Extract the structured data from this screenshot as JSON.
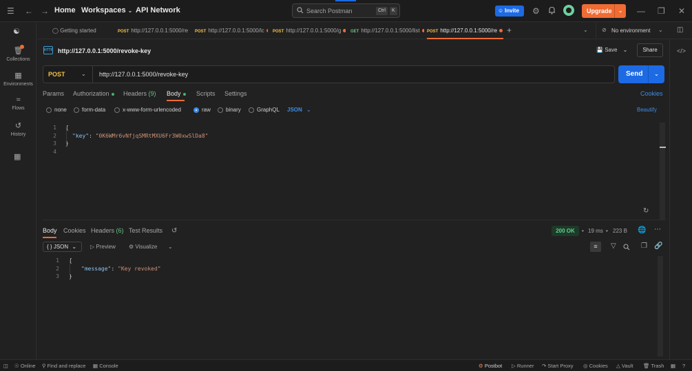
{
  "titlebar": {
    "home": "Home",
    "workspaces": "Workspaces",
    "api_network": "API Network",
    "search_placeholder": "Search Postman",
    "kbd_ctrl": "Ctrl",
    "kbd_k": "K",
    "invite": "Invite",
    "upgrade": "Upgrade"
  },
  "sidebar": {
    "items": [
      {
        "label": "Collections",
        "icon": "collections-icon"
      },
      {
        "label": "Environments",
        "icon": "environments-icon"
      },
      {
        "label": "Flows",
        "icon": "flows-icon"
      },
      {
        "label": "History",
        "icon": "history-icon"
      }
    ]
  },
  "tabs": {
    "getting_started": "Getting started",
    "items": [
      {
        "method": "POST",
        "url": "http://127.0.0.1:5000/re"
      },
      {
        "method": "POST",
        "url": "http://127.0.0.1:5000/lc"
      },
      {
        "method": "POST",
        "url": "http://127.0.0.1:5000/g"
      },
      {
        "method": "GET",
        "url": "http://127.0.0.1:5000/list"
      },
      {
        "method": "POST",
        "url": "http://127.0.0.1:5000/re"
      }
    ],
    "environment": "No environment"
  },
  "request": {
    "title": "http://127.0.0.1:5000/revoke-key",
    "save": "Save",
    "share": "Share",
    "method": "POST",
    "url": "http://127.0.0.1:5000/revoke-key",
    "send": "Send",
    "subtabs": {
      "params": "Params",
      "authorization": "Authorization",
      "headers": "Headers",
      "headers_count": "(9)",
      "body": "Body",
      "scripts": "Scripts",
      "settings": "Settings"
    },
    "cookies": "Cookies",
    "beautify": "Beautify",
    "body_types": [
      "none",
      "form-data",
      "x-www-form-urlencoded",
      "raw",
      "binary",
      "GraphQL"
    ],
    "body_format": "JSON",
    "code": {
      "line1": "{",
      "line2_key": "\"key\"",
      "line2_sep": ": ",
      "line2_val": "\"0K6WMr6vNfjqSMRtMXU6Fr3W0xwSlDa8\"",
      "line3": "}",
      "lines": [
        "1",
        "2",
        "3",
        "4"
      ]
    }
  },
  "response": {
    "tabs": {
      "body": "Body",
      "cookies": "Cookies",
      "headers": "Headers",
      "headers_count": "(6)",
      "test_results": "Test Results"
    },
    "status": "200 OK",
    "time": "19 ms",
    "size": "223 B",
    "format": "JSON",
    "preview": "Preview",
    "visualize": "Visualize",
    "code": {
      "line1": "{",
      "line2_key": "\"message\"",
      "line2_sep": ": ",
      "line2_val": "\"Key revoked\"",
      "line3": "}",
      "lines": [
        "1",
        "2",
        "3"
      ]
    }
  },
  "statusbar": {
    "online": "Online",
    "find_replace": "Find and replace",
    "console": "Console",
    "postbot": "Postbot",
    "runner": "Runner",
    "start_proxy": "Start Proxy",
    "cookies": "Cookies",
    "vault": "Vault",
    "trash": "Trash"
  },
  "colors": {
    "accent_orange": "#ef6c35",
    "primary_blue": "#1d6ae5",
    "method_post": "#f5c049",
    "method_get": "#6bc389",
    "status_ok": "#5fd08b"
  }
}
